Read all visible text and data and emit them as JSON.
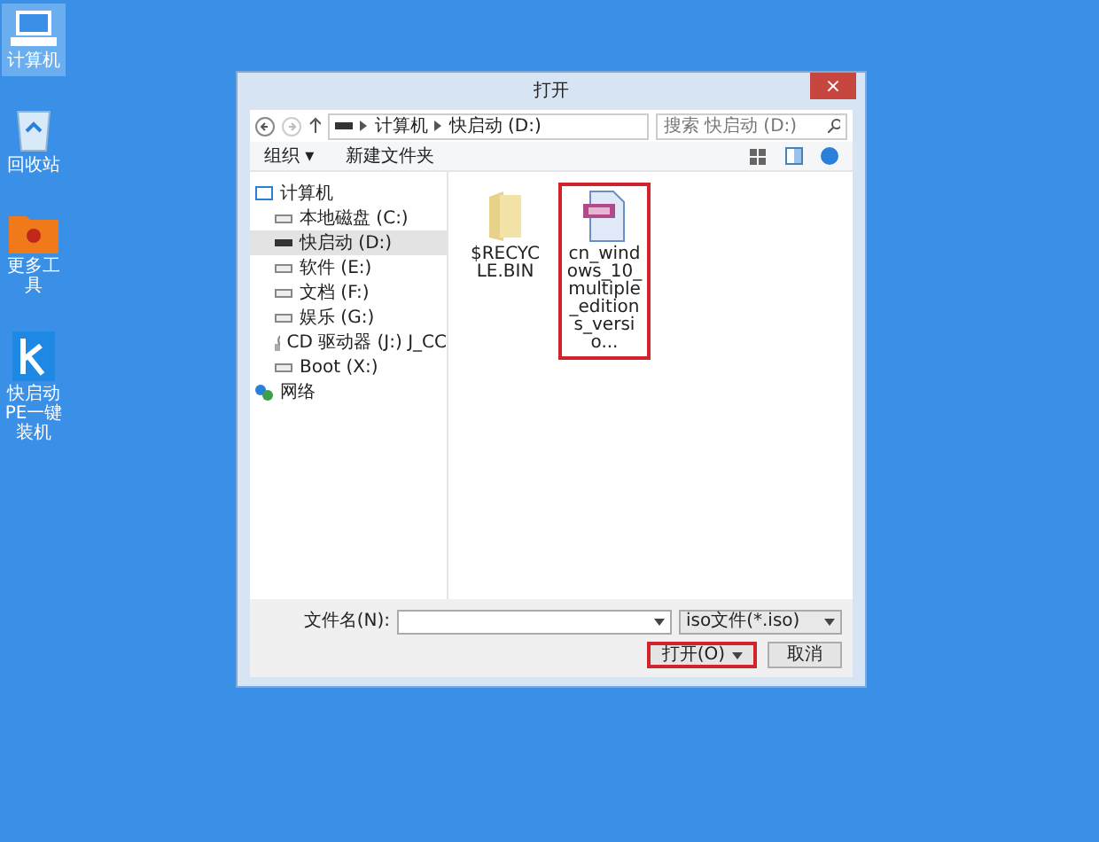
{
  "desktop_icons": [
    {
      "kind": "computer",
      "label": "计算机",
      "selected": true
    },
    {
      "kind": "recycle",
      "label": "回收站",
      "selected": false
    },
    {
      "kind": "tools",
      "label": "更多工具",
      "selected": false
    },
    {
      "kind": "app",
      "label": "快启动PE一键装机",
      "selected": false
    }
  ],
  "dialog": {
    "title": "打开",
    "close": "×",
    "breadcrumb": [
      "计算机",
      "快启动 (D:)"
    ],
    "search": {
      "placeholder": "搜索 快启动 (D:)"
    },
    "toolbar": {
      "organize": "组织 ▾",
      "new_folder": "新建文件夹"
    },
    "nav": [
      {
        "kind": "computer",
        "label": "计算机",
        "selected": false,
        "children": [
          {
            "kind": "disk",
            "label": "本地磁盘 (C:)",
            "selected": false
          },
          {
            "kind": "usb",
            "label": "快启动 (D:)",
            "selected": true
          },
          {
            "kind": "disk",
            "label": "软件 (E:)",
            "selected": false
          },
          {
            "kind": "disk",
            "label": "文档 (F:)",
            "selected": false
          },
          {
            "kind": "disk",
            "label": "娱乐 (G:)",
            "selected": false
          },
          {
            "kind": "cd",
            "label": "CD 驱动器 (J:) J_CC",
            "selected": false
          },
          {
            "kind": "disk",
            "label": "Boot (X:)",
            "selected": false
          }
        ]
      },
      {
        "kind": "network",
        "label": "网络",
        "selected": false
      }
    ],
    "files": [
      {
        "kind": "folder",
        "name": "$RECYCLE.BIN",
        "highlighted": false
      },
      {
        "kind": "iso",
        "name": "cn_windows_10_multiple_editions_versio...",
        "highlighted": true
      }
    ],
    "filename": {
      "label": "文件名(N):"
    },
    "filetype": "iso文件(*.iso)",
    "buttons": [
      {
        "kind": "open",
        "label": "打开(O)",
        "highlighted": true
      },
      {
        "kind": "cancel",
        "label": "取消",
        "highlighted": false
      }
    ]
  }
}
